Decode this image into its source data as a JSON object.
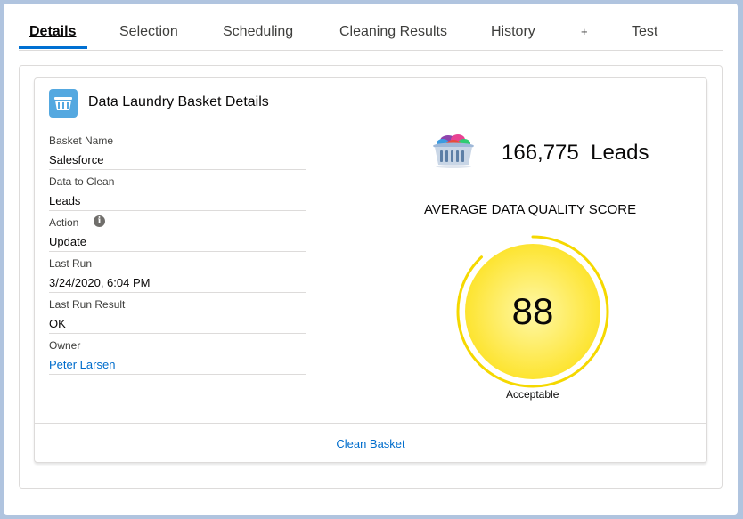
{
  "tabs": [
    {
      "label": "Details",
      "active": true
    },
    {
      "label": "Selection"
    },
    {
      "label": "Scheduling"
    },
    {
      "label": "Cleaning Results"
    },
    {
      "label": "History"
    },
    {
      "label": "+"
    },
    {
      "label": "Test"
    }
  ],
  "card": {
    "title": "Data Laundry Basket Details",
    "icon": "basket-icon",
    "fields": [
      {
        "label": "Basket Name",
        "value": "Salesforce"
      },
      {
        "label": "Data to Clean",
        "value": "Leads"
      },
      {
        "label": "Action",
        "value": "Update",
        "info_icon": "i"
      },
      {
        "label": "Last Run",
        "value": "3/24/2020, 6:04 PM"
      },
      {
        "label": "Last Run Result",
        "value": "OK"
      },
      {
        "label": "Owner",
        "value": "Peter Larsen"
      }
    ],
    "footer_link": "Clean Basket"
  },
  "summary": {
    "record_count": "166,775",
    "record_object": "Leads",
    "score_heading": "AVERAGE DATA QUALITY SCORE",
    "score": "88",
    "score_fraction": 0.88,
    "score_status": "Acceptable"
  },
  "colors": {
    "accent": "#0070d2",
    "link": "#006dcc",
    "icon_bg": "#54a8e0",
    "gauge_ring": "#f5d800",
    "gauge_fill_center": "#fff8a8",
    "gauge_fill_edge": "#fde430"
  }
}
